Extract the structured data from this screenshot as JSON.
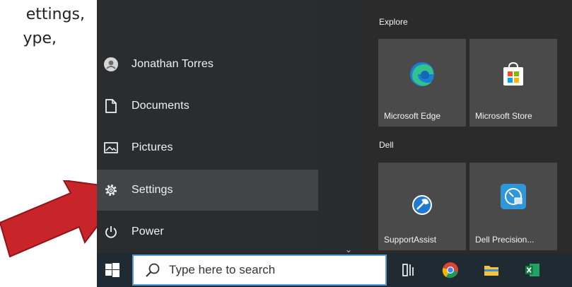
{
  "document": {
    "line1": "ettings,",
    "line2": "ype,"
  },
  "start_menu": {
    "user": {
      "name": "Jonathan Torres",
      "icon": "user-avatar-icon"
    },
    "items": [
      {
        "label": "Documents",
        "icon": "document-icon"
      },
      {
        "label": "Pictures",
        "icon": "pictures-icon"
      },
      {
        "label": "Settings",
        "icon": "gear-icon",
        "active": true
      },
      {
        "label": "Power",
        "icon": "power-icon"
      }
    ],
    "groups": [
      {
        "label": "Explore",
        "tiles": [
          {
            "label": "Microsoft Edge",
            "icon": "edge-icon"
          },
          {
            "label": "Microsoft Store",
            "icon": "store-icon"
          }
        ]
      },
      {
        "label": "Dell",
        "tiles": [
          {
            "label": "SupportAssist",
            "icon": "supportassist-icon"
          },
          {
            "label": "Dell Precision...",
            "icon": "dell-precision-icon"
          }
        ]
      }
    ]
  },
  "taskbar": {
    "search_placeholder": "Type here to search",
    "icons": [
      "windows-icon",
      "task-view-icon",
      "chrome-icon",
      "file-explorer-icon",
      "excel-icon"
    ]
  },
  "colors": {
    "annotation_arrow": "#c8252b",
    "active_item": "#434445",
    "taskbar": "#1f2a33"
  }
}
